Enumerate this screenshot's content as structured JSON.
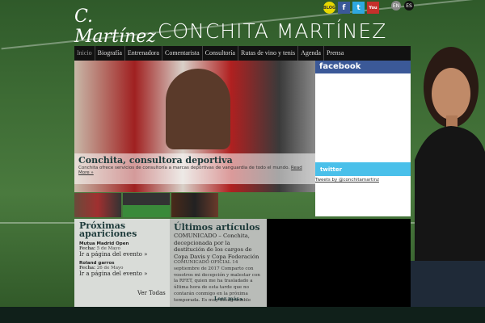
{
  "header": {
    "signature": "C. Martínez",
    "title": "CONCHITA MARTÍNEZ"
  },
  "social": [
    {
      "name": "blog",
      "label": "BLOG",
      "color": "#e8d800"
    },
    {
      "name": "facebook",
      "label": "f",
      "color": "#3b5998"
    },
    {
      "name": "twitter",
      "label": "t",
      "color": "#2fa8e0"
    },
    {
      "name": "youtube",
      "label": "You",
      "color": "#c4302b"
    }
  ],
  "languages": [
    "EN",
    "ES"
  ],
  "nav": [
    "Inicio",
    "Biografía",
    "Entrenadora",
    "Comentarista",
    "Consultoría",
    "Rutas de vino y tenis",
    "Agenda",
    "Prensa"
  ],
  "hero": {
    "title": "Conchita, consultora deportiva",
    "text": "Conchita ofrece servicios de consultoría a marcas deportivas de vanguardia de todo el mundo.",
    "read_more": "Read More »"
  },
  "facebook": {
    "label": "facebook"
  },
  "twitter": {
    "label": "twitter",
    "link": "Tweets by @conchitamartinz"
  },
  "upcoming": {
    "title": "Próximas apariciones",
    "events": [
      {
        "name": "Mutua Madrid Open",
        "date_label": "Fecha:",
        "date": "5 de Mayo",
        "link": "Ir a página del evento »"
      },
      {
        "name": "Roland garros",
        "date_label": "Fecha:",
        "date": "26 de Mayo",
        "link": "Ir a página del evento »"
      }
    ],
    "view_all": "Ver Todas"
  },
  "articles": {
    "title": "Últimos artículos",
    "headline": "COMUNICADO – Conchita, decepcionada por la destitución de los cargos de Copa Davis y Copa Federación",
    "body": "COMUNICADO OFICIAL 14 septiembre de 2017 Comparto con vosotros mi decepción y malestar con la RFET, quien me ha trasladado a última hora de esta tarde que no contarán conmigo en la próxima temporada. Es muy desagradable",
    "read_more": "Leer más ▸"
  }
}
